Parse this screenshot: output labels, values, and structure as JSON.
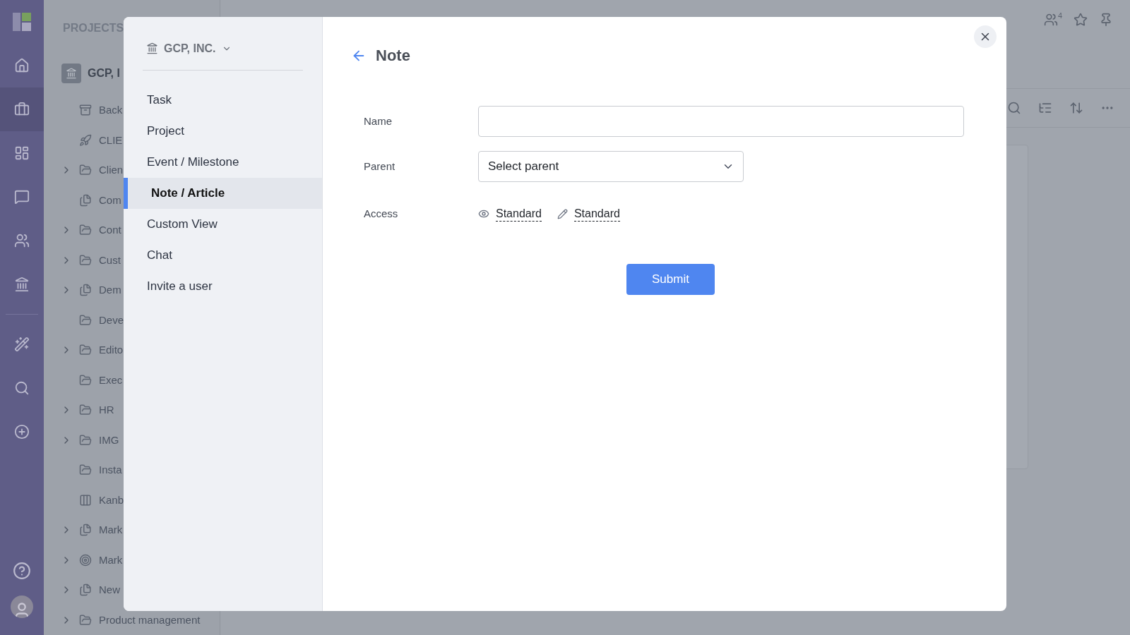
{
  "rail": {
    "items": [
      {
        "kind": "home",
        "selected": false
      },
      {
        "kind": "briefcase",
        "selected": true
      },
      {
        "kind": "dashboard",
        "selected": false
      },
      {
        "kind": "chat",
        "selected": false
      },
      {
        "kind": "users",
        "selected": false
      },
      {
        "kind": "bank",
        "selected": false
      },
      {
        "kind": "wand",
        "selected": false
      },
      {
        "kind": "search",
        "selected": false
      },
      {
        "kind": "add",
        "selected": false
      }
    ]
  },
  "projects": {
    "title": "PROJECTS",
    "root": "GCP, I",
    "items": [
      {
        "label": "Back",
        "kind": "archive",
        "has_children": false
      },
      {
        "label": "CLIE",
        "kind": "rocket",
        "has_children": false
      },
      {
        "label": "Clien",
        "kind": "folder",
        "has_children": true
      },
      {
        "label": "Com",
        "kind": "docs",
        "has_children": false
      },
      {
        "label": "Cont",
        "kind": "folder",
        "has_children": true
      },
      {
        "label": "Cust",
        "kind": "folder",
        "has_children": true
      },
      {
        "label": "Dem",
        "kind": "docs",
        "has_children": true
      },
      {
        "label": "Deve",
        "kind": "folder",
        "has_children": false
      },
      {
        "label": "Edito",
        "kind": "folder",
        "has_children": true
      },
      {
        "label": "Exec",
        "kind": "folder",
        "has_children": false
      },
      {
        "label": "HR",
        "kind": "folder",
        "has_children": true
      },
      {
        "label": "IMG",
        "kind": "folder",
        "has_children": true
      },
      {
        "label": "Insta",
        "kind": "folder",
        "has_children": false
      },
      {
        "label": "Kanb",
        "kind": "kanban",
        "has_children": false
      },
      {
        "label": "Mark",
        "kind": "docs",
        "has_children": true
      },
      {
        "label": "Mark",
        "kind": "target",
        "has_children": true
      },
      {
        "label": "New",
        "kind": "docs",
        "has_children": true
      },
      {
        "label": "Product management",
        "kind": "folder",
        "has_children": true
      }
    ]
  },
  "header": {
    "members_count": "4"
  },
  "modal": {
    "org": "GCP, INC.",
    "menu": [
      {
        "label": "Task",
        "selected": false
      },
      {
        "label": "Project",
        "selected": false
      },
      {
        "label": "Event / Milestone",
        "selected": false
      },
      {
        "label": "Note / Article",
        "selected": true
      },
      {
        "label": "Custom View",
        "selected": false
      },
      {
        "label": "Chat",
        "selected": false
      },
      {
        "label": "Invite a user",
        "selected": false
      }
    ],
    "title": "Note",
    "fields": [
      {
        "kind": "text",
        "label": "Name"
      },
      {
        "kind": "select",
        "label": "Parent",
        "value": "Select parent"
      },
      {
        "kind": "access",
        "label": "Access",
        "view": "Standard",
        "edit": "Standard"
      }
    ],
    "submit": "Submit"
  }
}
